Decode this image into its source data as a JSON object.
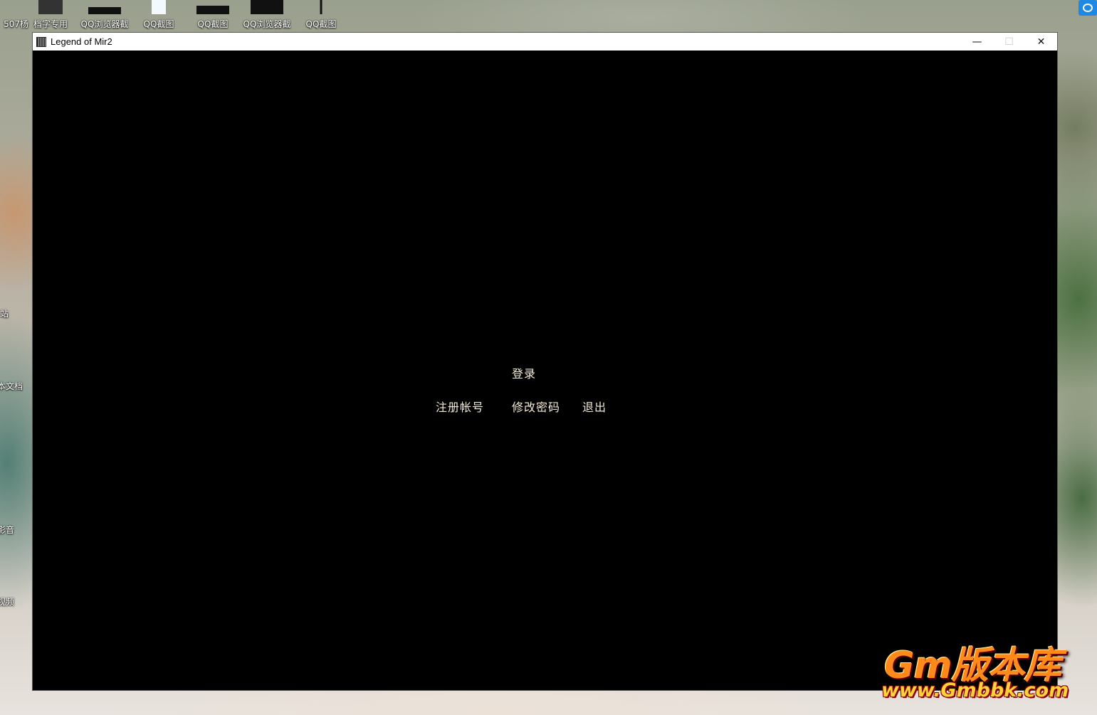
{
  "desktop": {
    "top_icons": [
      {
        "label": "507杨"
      },
      {
        "label": "档字专用"
      },
      {
        "label": "QQ浏览器截"
      },
      {
        "label": "QQ截图"
      },
      {
        "label": "QQ截图"
      },
      {
        "label": "QQ浏览器截"
      },
      {
        "label": "QQ截图"
      }
    ],
    "side_labels": [
      "站",
      "本文档",
      "影音",
      "视频"
    ]
  },
  "window": {
    "title": "Legend of Mir2",
    "minimize": "—",
    "maximize": "☐",
    "close": "✕"
  },
  "game_menu": {
    "login": "登录",
    "register": "注册帐号",
    "change_password": "修改密码",
    "exit": "退出"
  },
  "watermark": {
    "line1": "Gm版本库",
    "line2": "www.Gmbbk.com"
  },
  "colors": {
    "menu_text": "#f2ead8",
    "game_background": "#000000",
    "watermark_orange": "#ff8a1a"
  }
}
